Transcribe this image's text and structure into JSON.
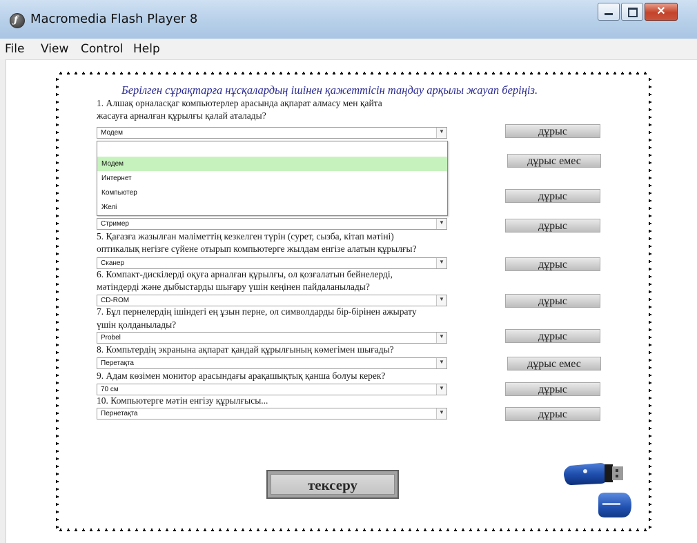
{
  "window": {
    "title": "Macromedia Flash Player 8",
    "close_glyph": "✕"
  },
  "menu": [
    "File",
    "View",
    "Control",
    "Help"
  ],
  "heading": "Берілген сұрақтарға нұсқалардың ішінен қажеттісін таңдау арқылы жауап беріңіз.",
  "questions": {
    "q1_line1": "1. Алшақ орналасқаг компьютерлер арасында ақпарат алмасу мен қайта",
    "q1_line2": "жасауға арналған құрылғы қалай аталады?",
    "q5_line1": "5. Қағазға жазылған мәліметтің кезкелген түрін (сурет, сызба, кітап мәтіні)",
    "q5_line2": "оптикалық негізге сүйене отырып компьютерге жылдам енгізе алатын құрылғы?",
    "q6_line1": "6. Компакт-дискілерді оқуға арналған құрылғы, ол қозғалатын бейнелерді,",
    "q6_line2": "мәтіндерді және дыбыстарды шығару үшін кеңінен пайдаланылады?",
    "q7_line1": "7. Бұл пернелердің ішіндегі ең ұзын перне, ол символдарды бір-бірінен ажырату",
    "q7_line2": "үшін қолданылады?",
    "q8_line1": "8. Компьтердің экранына ақпарат қандай құрылғының көмегімен шығады?",
    "q9_line1": "9. Адам көзімен монитор арасындағы арақашықтық қанша болуы керек?",
    "q10_line1": "10. Компьютерге мәтін енгізу құрылғысы..."
  },
  "answers": {
    "q1": "Модем",
    "q4": "Стример",
    "q5": "Сканер",
    "q6": "CD-ROM",
    "q7": "Probel",
    "q8": "Перетақта",
    "q9": "70 см",
    "q10": "Пернетақта"
  },
  "dropdown_options": [
    "Модем",
    "Интернет",
    "Компьютер",
    "Желі"
  ],
  "results": [
    "дұрыс",
    "дұрыс емес",
    "дұрыс",
    "дұрыс",
    "дұрыс",
    "дұрыс",
    "дұрыс",
    "дұрыс емес",
    "дұрыс",
    "дұрыс"
  ],
  "check_button": "тексеру",
  "colors": {
    "heading": "#2a2a92",
    "selected_option": "#c6f3bd"
  }
}
